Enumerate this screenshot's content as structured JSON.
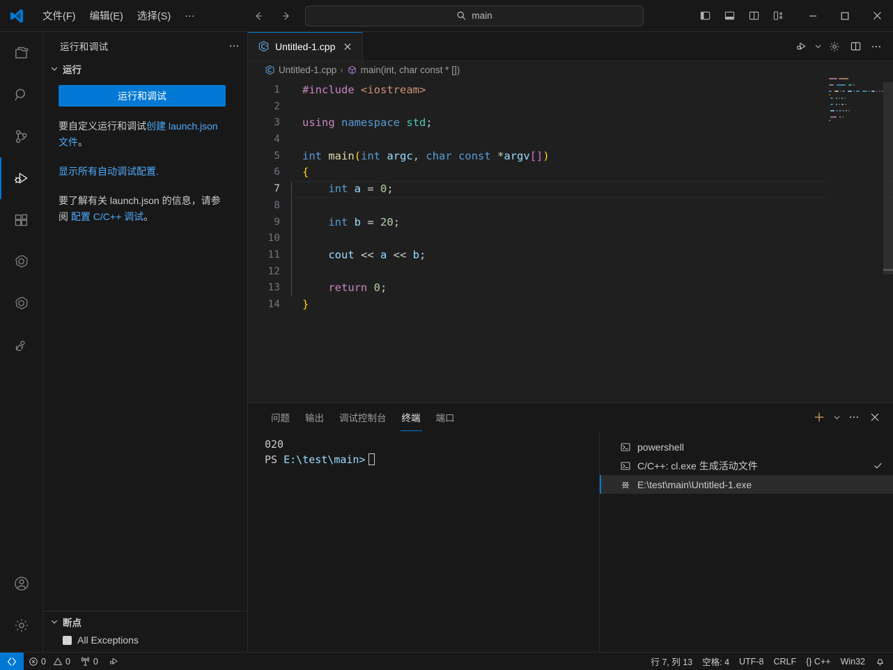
{
  "titlebar": {
    "menus": [
      {
        "label": "文件(F)",
        "name": "menu-file"
      },
      {
        "label": "编辑(E)",
        "name": "menu-edit"
      },
      {
        "label": "选择(S)",
        "name": "menu-select"
      },
      {
        "label": "···",
        "name": "menu-more"
      }
    ],
    "search_value": "main",
    "back_icon": "arrow-left-icon",
    "forward_icon": "arrow-right-icon",
    "layout_icons": [
      "toggle-primary-sidebar-icon",
      "toggle-panel-icon",
      "toggle-secondary-sidebar-icon",
      "customize-layout-icon"
    ],
    "window_controls": [
      "minimize",
      "maximize",
      "close"
    ]
  },
  "activitybar": {
    "items": [
      {
        "name": "explorer",
        "icon": "files-icon",
        "active": false
      },
      {
        "name": "search",
        "icon": "search-icon",
        "active": false
      },
      {
        "name": "source-control",
        "icon": "source-control-icon",
        "active": false
      },
      {
        "name": "run-and-debug",
        "icon": "run-debug-icon",
        "active": true
      },
      {
        "name": "extensions",
        "icon": "extensions-icon",
        "active": false
      },
      {
        "name": "openai-chat",
        "icon": "openai-icon",
        "active": false
      },
      {
        "name": "openai-codex",
        "icon": "openai-icon",
        "active": false
      },
      {
        "name": "remote-explorer",
        "icon": "person-run-icon",
        "active": false
      }
    ],
    "bottom_items": [
      {
        "name": "accounts",
        "icon": "account-icon"
      },
      {
        "name": "manage-settings",
        "icon": "gear-icon"
      }
    ]
  },
  "sidebar": {
    "title": "运行和调试",
    "more_actions_icon": "ellipsis-icon",
    "run_section": {
      "label": "运行",
      "chevron": "chevron-down-icon",
      "button_label": "运行和调试",
      "hint1_prefix": "要自定义运行和调试",
      "hint1_link1": "创建 launch.json 文件",
      "hint1_suffix": "。",
      "hint2_link": "显示所有自动调试配置.",
      "hint3_prefix": "要了解有关 launch.json 的信息，请参阅 ",
      "hint3_link": "配置 C/C++ 调试",
      "hint3_suffix": "。"
    },
    "breakpoints_section": {
      "label": "断点",
      "chevron": "chevron-down-icon",
      "items": [
        {
          "label": "All Exceptions",
          "checked": true
        }
      ]
    }
  },
  "editor": {
    "tabs": [
      {
        "label": "Untitled-1.cpp",
        "icon": "cpp-file-icon",
        "active": true,
        "close_icon": "close-icon"
      }
    ],
    "toolbar_icons": [
      "run-debug-icon",
      "chevron-down-icon",
      "gear-icon",
      "split-editor-icon",
      "ellipsis-icon"
    ],
    "breadcrumb": [
      {
        "label": "Untitled-1.cpp",
        "icon": "cpp-file-icon"
      },
      {
        "label": "main(int, char const * [])",
        "icon": "symbol-method-icon"
      }
    ],
    "cursor_line": 7,
    "lines": [
      {
        "n": 1,
        "tokens": [
          {
            "t": "#include ",
            "c": "pre"
          },
          {
            "t": "<iostream>",
            "c": "str"
          }
        ]
      },
      {
        "n": 2,
        "tokens": []
      },
      {
        "n": 3,
        "tokens": [
          {
            "t": "using",
            "c": "kp"
          },
          {
            "t": " ",
            "c": "op"
          },
          {
            "t": "namespace",
            "c": "k"
          },
          {
            "t": " ",
            "c": "op"
          },
          {
            "t": "std",
            "c": "typ"
          },
          {
            "t": ";",
            "c": "op"
          }
        ]
      },
      {
        "n": 4,
        "tokens": []
      },
      {
        "n": 5,
        "tokens": [
          {
            "t": "int",
            "c": "k"
          },
          {
            "t": " ",
            "c": "op"
          },
          {
            "t": "main",
            "c": "fn"
          },
          {
            "t": "(",
            "c": "brk"
          },
          {
            "t": "int",
            "c": "k"
          },
          {
            "t": " ",
            "c": "op"
          },
          {
            "t": "argc",
            "c": "var"
          },
          {
            "t": ", ",
            "c": "op"
          },
          {
            "t": "char",
            "c": "k"
          },
          {
            "t": " ",
            "c": "op"
          },
          {
            "t": "const",
            "c": "k"
          },
          {
            "t": " *",
            "c": "op"
          },
          {
            "t": "argv",
            "c": "var"
          },
          {
            "t": "[",
            "c": "brk2"
          },
          {
            "t": "]",
            "c": "brk2"
          },
          {
            "t": ")",
            "c": "brk"
          }
        ]
      },
      {
        "n": 6,
        "tokens": [
          {
            "t": "{",
            "c": "brk"
          }
        ]
      },
      {
        "n": 7,
        "tokens": [
          {
            "t": "    ",
            "c": "op"
          },
          {
            "t": "int",
            "c": "k"
          },
          {
            "t": " ",
            "c": "op"
          },
          {
            "t": "a",
            "c": "var"
          },
          {
            "t": " = ",
            "c": "op"
          },
          {
            "t": "0",
            "c": "num"
          },
          {
            "t": ";",
            "c": "op"
          }
        ]
      },
      {
        "n": 8,
        "tokens": []
      },
      {
        "n": 9,
        "tokens": [
          {
            "t": "    ",
            "c": "op"
          },
          {
            "t": "int",
            "c": "k"
          },
          {
            "t": " ",
            "c": "op"
          },
          {
            "t": "b",
            "c": "var"
          },
          {
            "t": " = ",
            "c": "op"
          },
          {
            "t": "20",
            "c": "num"
          },
          {
            "t": ";",
            "c": "op"
          }
        ]
      },
      {
        "n": 10,
        "tokens": []
      },
      {
        "n": 11,
        "tokens": [
          {
            "t": "    ",
            "c": "op"
          },
          {
            "t": "cout",
            "c": "var"
          },
          {
            "t": " << ",
            "c": "op"
          },
          {
            "t": "a",
            "c": "var"
          },
          {
            "t": " << ",
            "c": "op"
          },
          {
            "t": "b",
            "c": "var"
          },
          {
            "t": ";",
            "c": "op"
          }
        ]
      },
      {
        "n": 12,
        "tokens": []
      },
      {
        "n": 13,
        "tokens": [
          {
            "t": "    ",
            "c": "op"
          },
          {
            "t": "return",
            "c": "kp"
          },
          {
            "t": " ",
            "c": "op"
          },
          {
            "t": "0",
            "c": "num"
          },
          {
            "t": ";",
            "c": "op"
          }
        ]
      },
      {
        "n": 14,
        "tokens": [
          {
            "t": "}",
            "c": "brk"
          }
        ]
      }
    ]
  },
  "panel": {
    "tabs": [
      {
        "label": "问题",
        "name": "tab-problems",
        "active": false
      },
      {
        "label": "输出",
        "name": "tab-output",
        "active": false
      },
      {
        "label": "调试控制台",
        "name": "tab-debug-console",
        "active": false
      },
      {
        "label": "终端",
        "name": "tab-terminal",
        "active": true
      },
      {
        "label": "端口",
        "name": "tab-ports",
        "active": false
      }
    ],
    "actions": [
      "new-terminal-icon",
      "chevron-down-icon",
      "ellipsis-icon",
      "close-icon"
    ],
    "terminal": {
      "output_line": "020",
      "prompt_prefix": "PS ",
      "prompt_path": "E:\\test\\main>"
    },
    "terminal_tabs": [
      {
        "label": "powershell",
        "icon": "terminal-powershell-icon",
        "selected": false,
        "checked": false
      },
      {
        "label": "C/C++: cl.exe 生成活动文件",
        "icon": "terminal-powershell-icon",
        "selected": false,
        "checked": true
      },
      {
        "label": "E:\\test\\main\\Untitled-1.exe",
        "icon": "debug-console-icon",
        "selected": true,
        "checked": false
      }
    ]
  },
  "statusbar": {
    "remote_icon": "remote-window-icon",
    "left_items": [
      {
        "name": "problems-errors",
        "icon": "error-icon",
        "label": "0"
      },
      {
        "name": "problems-warnings",
        "icon": "warning-icon",
        "label": "0"
      },
      {
        "name": "ports-forwarded",
        "icon": "radio-tower-icon",
        "label": "0"
      },
      {
        "name": "run-debug-status",
        "icon": "run-debug-icon",
        "label": ""
      }
    ],
    "right_items": [
      {
        "name": "editor-position",
        "label": "行 7, 列 13"
      },
      {
        "name": "editor-indentation",
        "label": "空格: 4"
      },
      {
        "name": "editor-encoding",
        "label": "UTF-8"
      },
      {
        "name": "editor-eol",
        "label": "CRLF"
      },
      {
        "name": "editor-language",
        "label": "{} C++"
      },
      {
        "name": "editor-platform",
        "label": "Win32"
      },
      {
        "name": "notifications",
        "label": "",
        "icon": "bell-icon"
      }
    ]
  },
  "colors": {
    "accent": "#0078d4",
    "background": "#1f1f1f",
    "chrome": "#181818",
    "link": "#4daafc",
    "text": "#cccccc"
  }
}
